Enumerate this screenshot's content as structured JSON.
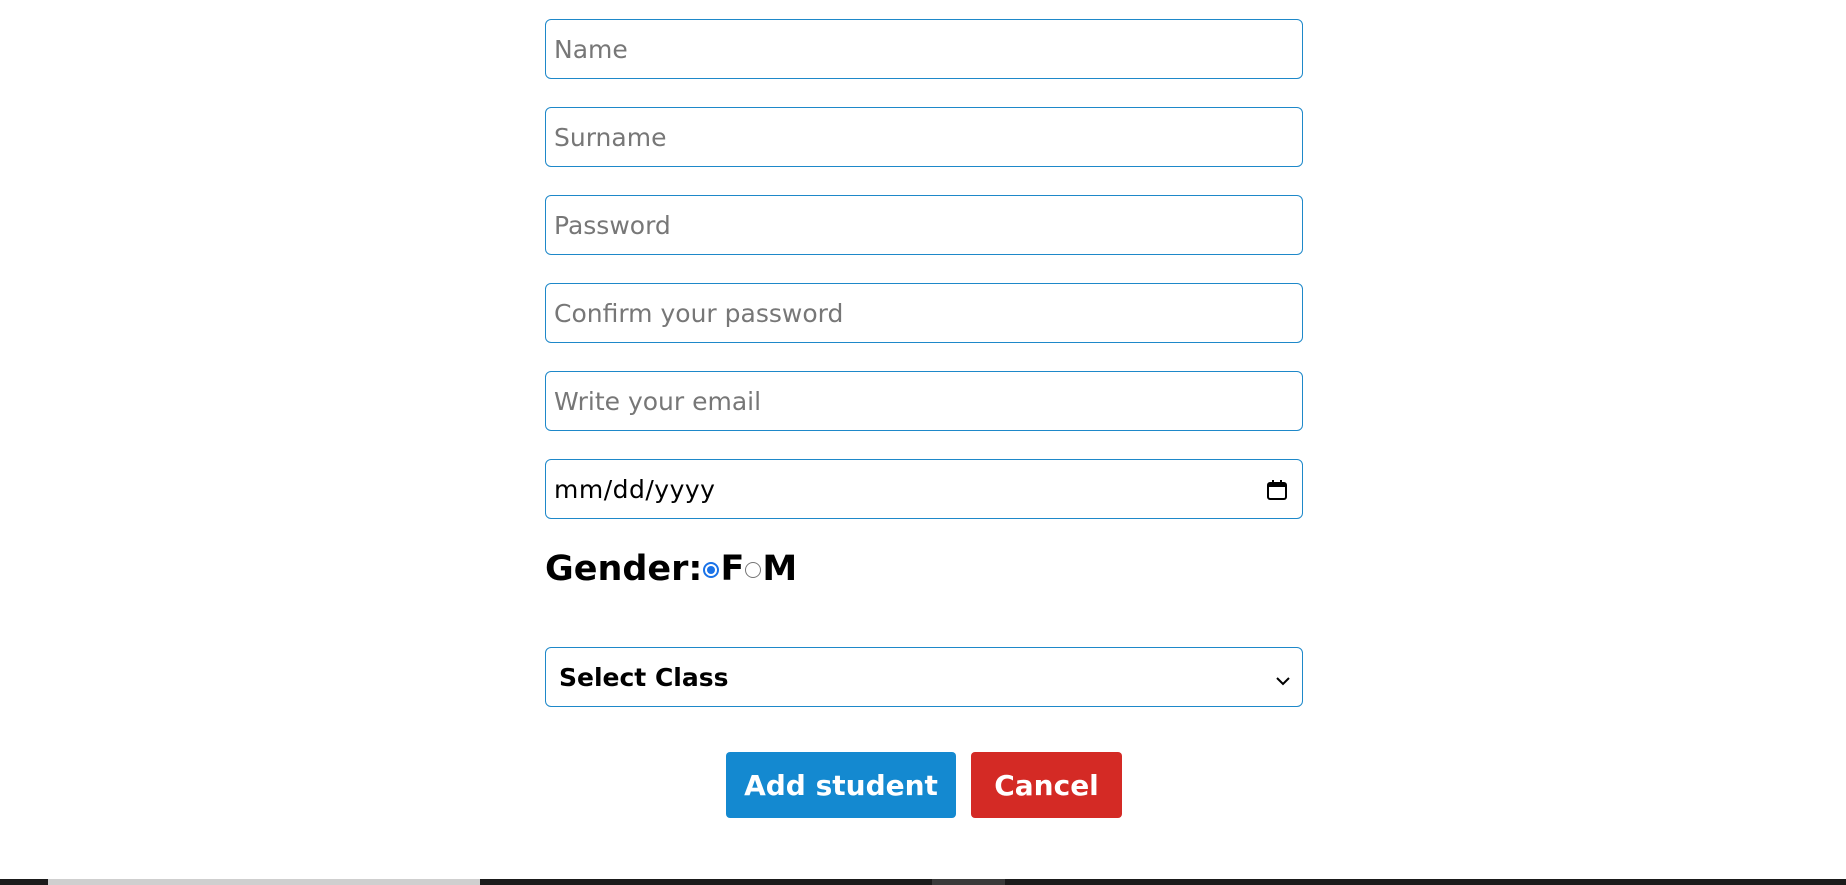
{
  "form": {
    "name_placeholder": "Name",
    "surname_placeholder": "Surname",
    "password_placeholder": "Password",
    "confirm_password_placeholder": "Confirm your password",
    "email_placeholder": "Write your email",
    "date_placeholder": "mm/dd/yyyy",
    "gender": {
      "label": "Gender:",
      "options": [
        "F",
        "M"
      ],
      "selected": "F"
    },
    "class_select": {
      "selected": "Select Class"
    },
    "add_button": "Add student",
    "cancel_button": "Cancel"
  },
  "colors": {
    "field_border": "#1e88c9",
    "add_button": "#1489d0",
    "cancel_button": "#d42a25",
    "radio_selected": "#1a73e8"
  },
  "icons": {
    "date": "calendar-icon",
    "select": "chevron-down-icon"
  }
}
